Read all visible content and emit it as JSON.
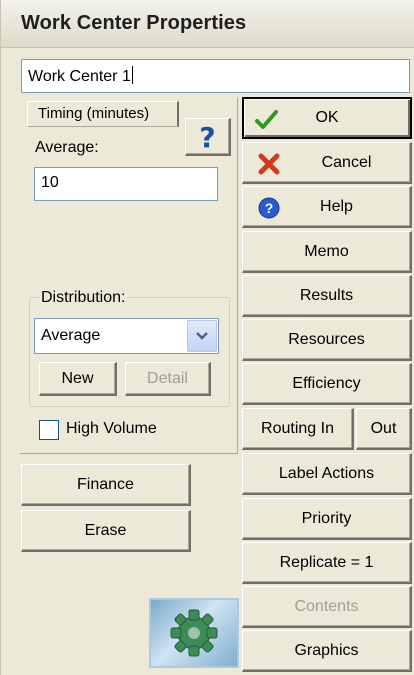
{
  "window": {
    "title": "Work Center Properties"
  },
  "name_field": {
    "value": "Work Center 1"
  },
  "timing": {
    "tab_label": "Timing (minutes)",
    "help_glyph": "?",
    "average_label": "Average:",
    "average_value": "10"
  },
  "distribution": {
    "legend": "Distribution:",
    "selected": "Average",
    "new_label": "New",
    "detail_label": "Detail"
  },
  "high_volume": {
    "label": "High Volume",
    "checked": false
  },
  "left_buttons": {
    "finance": "Finance",
    "erase": "Erase"
  },
  "right_buttons": {
    "ok": "OK",
    "cancel": "Cancel",
    "help": "Help",
    "memo": "Memo",
    "results": "Results",
    "resources": "Resources",
    "efficiency": "Efficiency",
    "routing_in": "Routing In",
    "routing_out": "Out",
    "label_actions": "Label Actions",
    "priority": "Priority",
    "replicate": "Replicate = 1",
    "contents": "Contents",
    "graphics": "Graphics"
  },
  "icons": {
    "ok": "check-icon",
    "cancel": "x-icon",
    "help": "help-circle-icon",
    "timing_help": "question-icon",
    "dropdown": "chevron-down-icon",
    "logo": "gear-logo-icon"
  },
  "colors": {
    "ok_check": "#2f9a21",
    "cancel_x": "#d23a1c",
    "help_blue": "#2a5bd0",
    "question": "#1b4fa7"
  }
}
